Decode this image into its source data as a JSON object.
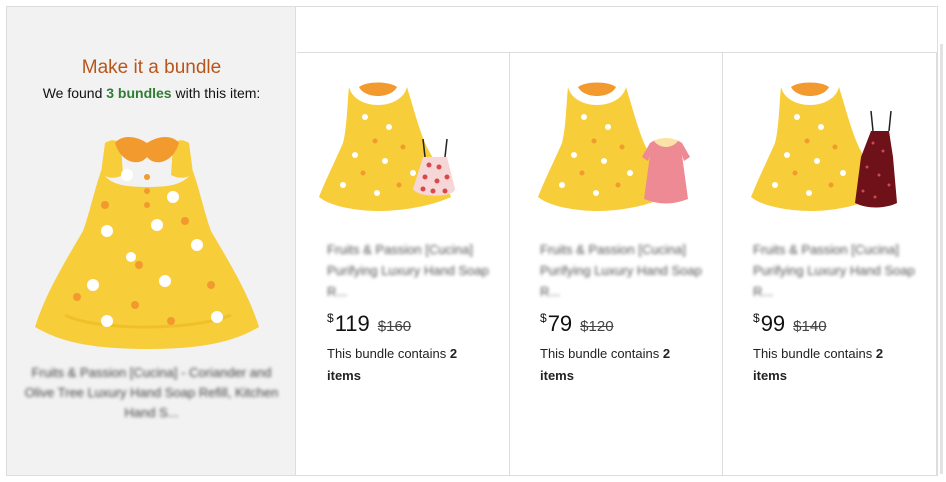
{
  "panel": {
    "title": "Make it a bundle",
    "subtitle_prefix": "We found",
    "subtitle_count": "3 bundles",
    "subtitle_suffix": "with this item:",
    "product_description": "Fruits & Passion [Cucina] - Coriander and Olive Tree Luxury Hand Soap Refill, Kitchen Hand S..."
  },
  "bundles": [
    {
      "title": "Fruits & Passion [Cucina] Purifying Luxury Hand Soap R...",
      "currency": "$",
      "price": "119",
      "old_price": "$160",
      "contains_text": "This bundle contains",
      "count": "2",
      "items_label": "items",
      "second_item_color": "#f6d6d6"
    },
    {
      "title": "Fruits & Passion [Cucina] Purifying Luxury Hand Soap R...",
      "currency": "$",
      "price": "79",
      "old_price": "$120",
      "contains_text": "This bundle contains",
      "count": "2",
      "items_label": "items",
      "second_item_color": "#ee8a93"
    },
    {
      "title": "Fruits & Passion [Cucina] Purifying Luxury Hand Soap R...",
      "currency": "$",
      "price": "99",
      "old_price": "$140",
      "contains_text": "This bundle contains",
      "count": "2",
      "items_label": "items",
      "second_item_color": "#6e1118"
    }
  ],
  "colors": {
    "title_orange": "#b8561a",
    "bundle_green": "#2f7d32",
    "dress_yellow": "#f7cd3a",
    "dress_collar": "#f29a2e"
  }
}
